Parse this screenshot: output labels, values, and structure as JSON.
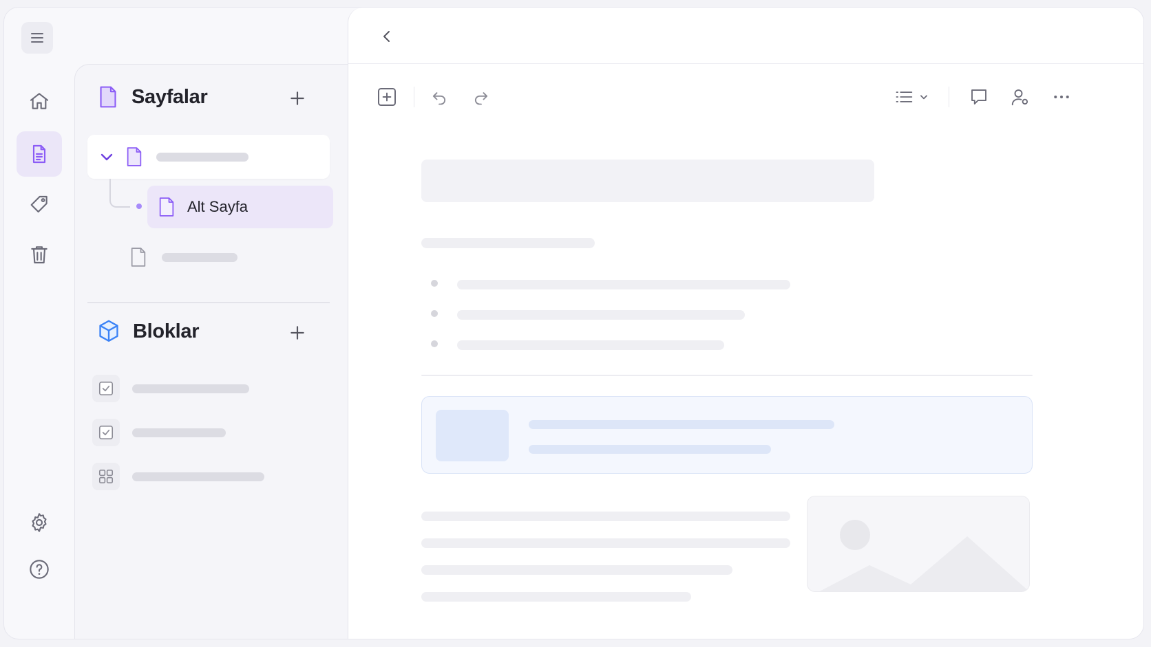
{
  "panel": {
    "pages": {
      "title": "Sayfalar",
      "child_label": "Alt Sayfa"
    },
    "blocks": {
      "title": "Bloklar"
    }
  },
  "colors": {
    "accent": "#8b5cf6",
    "blocks_accent": "#3b82f6",
    "active_bg": "#ece6f9"
  },
  "icons": {
    "rail": [
      "menu-icon",
      "home-icon",
      "document-icon",
      "tag-icon",
      "trash-icon",
      "settings-icon",
      "help-icon"
    ],
    "toolbar": [
      "add-block-icon",
      "undo-icon",
      "redo-icon",
      "list-view-icon",
      "comment-icon",
      "share-user-icon",
      "more-icon"
    ]
  }
}
